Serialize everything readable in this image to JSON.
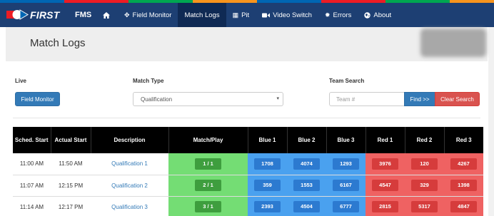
{
  "brand_strip_colors": [
    "#0066b3",
    "#ed1c24",
    "#00a651",
    "#f7941d",
    "#0066b3",
    "#ed1c24",
    "#00a651",
    "#f7941d"
  ],
  "nav": {
    "logo_text": "FIRST",
    "brand": "FMS",
    "items": [
      {
        "label": "",
        "icon": "home-icon"
      },
      {
        "label": "Field Monitor",
        "icon": "move-icon"
      },
      {
        "label": "Match Logs",
        "icon": "",
        "active": true
      },
      {
        "label": "Pit",
        "icon": "table-icon"
      },
      {
        "label": "Video Switch",
        "icon": "video-camera-icon"
      },
      {
        "label": "Errors",
        "icon": "cog-icon"
      },
      {
        "label": "About",
        "icon": "globe-icon"
      }
    ]
  },
  "header": {
    "title": "Match Logs"
  },
  "controls": {
    "live_label": "Live",
    "field_monitor_button": "Field Monitor",
    "match_type_label": "Match Type",
    "match_type_value": "Qualification",
    "team_search_label": "Team Search",
    "team_search_placeholder": "Team #",
    "find_button": "Find >>",
    "clear_search_button": "Clear Search"
  },
  "table": {
    "headers": {
      "sched_start": "Sched. Start",
      "actual_start": "Actual Start",
      "description": "Description",
      "match_play": "Match/Play",
      "blue1": "Blue 1",
      "blue2": "Blue 2",
      "blue3": "Blue 3",
      "red1": "Red 1",
      "red2": "Red 2",
      "red3": "Red 3"
    },
    "rows": [
      {
        "sched": "11:00 AM",
        "actual": "11:50 AM",
        "desc": "Qualification 1",
        "play": "1 / 1",
        "blue": [
          "1708",
          "4074",
          "1293"
        ],
        "red": [
          "3976",
          "120",
          "4267"
        ]
      },
      {
        "sched": "11:07 AM",
        "actual": "12:15 PM",
        "desc": "Qualification 2",
        "play": "2 / 1",
        "blue": [
          "359",
          "1553",
          "6167"
        ],
        "red": [
          "4547",
          "329",
          "1398"
        ]
      },
      {
        "sched": "11:14 AM",
        "actual": "12:17 PM",
        "desc": "Qualification 3",
        "play": "3 / 1",
        "blue": [
          "2393",
          "4504",
          "6777"
        ],
        "red": [
          "2815",
          "5317",
          "4847"
        ]
      }
    ]
  }
}
